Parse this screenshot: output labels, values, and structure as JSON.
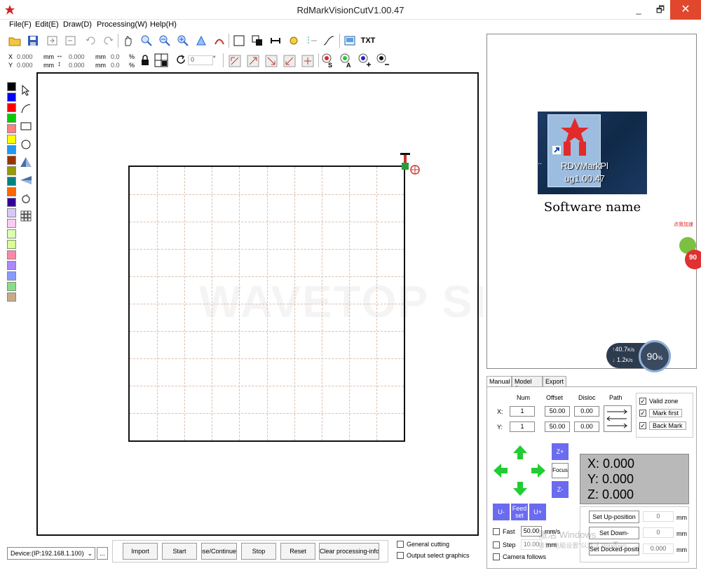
{
  "window": {
    "title": "RdMarkVisionCutV1.00.47",
    "min": "_",
    "restore": "🗗",
    "close": "✕"
  },
  "menu": [
    "File(F)",
    "Edit(E)",
    "Draw(D)",
    "Processing(W)",
    "Help(H)"
  ],
  "toolbar": {
    "txt_label": "TXT"
  },
  "position_bar": {
    "x_label": "X",
    "y_label": "Y",
    "x_value": "0.000",
    "y_value": "0.000",
    "unit": "mm",
    "w_value": "0.000",
    "h_value": "0.000",
    "w_pct": "0.0",
    "h_pct": "0.0",
    "pct": "%",
    "rotate_value": "0",
    "degree": "°",
    "s_label": "S",
    "a_label": "A"
  },
  "palette": [
    "#000000",
    "#0000ff",
    "#ff0000",
    "#00cc00",
    "#ff8080",
    "#ffff00",
    "#2299ee",
    "#993300",
    "#999900",
    "#008080",
    "#ff6600",
    "#330099",
    "#d8c8f8",
    "#ffccf0",
    "#ddffb0",
    "#d8ff90",
    "#ff88aa",
    "#aa88ff",
    "#8899ff",
    "#88dd88",
    "#c8aa88"
  ],
  "canvas": {
    "watermark": "WAVETOP SIGN"
  },
  "preview": {
    "icon_label_line1": "RDVMarkPl",
    "icon_label_line2": "ug1.00.47",
    "icon_dots": "..",
    "caption": "Software name",
    "speed_up": "40.7",
    "speed_up_unit": "K/s",
    "speed_down": "1.2",
    "speed_down_unit": "K/s",
    "gauge": "90",
    "gauge_unit": "%",
    "badge_text": "点我加速",
    "badge_value": "90"
  },
  "tabs": [
    "Manual",
    "Model Set",
    "Export"
  ],
  "manual": {
    "headers": {
      "num": "Num",
      "offset": "Offset",
      "disloc": "Disloc",
      "path": "Path"
    },
    "x_label": "X:",
    "y_label": "Y:",
    "x_num": "1",
    "y_num": "1",
    "x_offset": "50.00",
    "y_offset": "50.00",
    "x_disloc": "0.00",
    "y_disloc": "0.00",
    "valid_zone": "Valid zone",
    "mark_first": "Mark first",
    "back_mark": "Back Mark",
    "z_plus": "Z+",
    "z_minus": "Z-",
    "focus": "Focus",
    "u_minus": "U-",
    "u_plus": "U+",
    "feed_set": "Feed set",
    "coord_x": "X:  0.000",
    "coord_y": "Y:  0.000",
    "coord_z": "Z:  0.000",
    "fast": "Fast",
    "fast_value": "50.00",
    "fast_unit": "mm/s",
    "step": "Step",
    "step_value": "10.00",
    "step_unit": "mm",
    "camera_follows": "Camera follows",
    "set_up": "Set Up-position",
    "set_down": "Set Down-position",
    "set_docked": "Set Docked-position",
    "up_value": "0",
    "down_value": "0",
    "docked_value": "0.000",
    "pos_unit": "mm"
  },
  "bottom": {
    "device": "Device:(IP:192.168.1.100)",
    "ellipsis": "...",
    "import": "Import",
    "start": "Start",
    "pause": "Pause/Continue",
    "stop": "Stop",
    "reset": "Reset",
    "clear": "Clear processing-infor",
    "general_cutting": "General cutting",
    "output_select": "Output select graphics"
  },
  "os_overlay": {
    "line1": "激活 Windows",
    "line2": "转到\"电脑设置\"以激活 Windows。"
  }
}
